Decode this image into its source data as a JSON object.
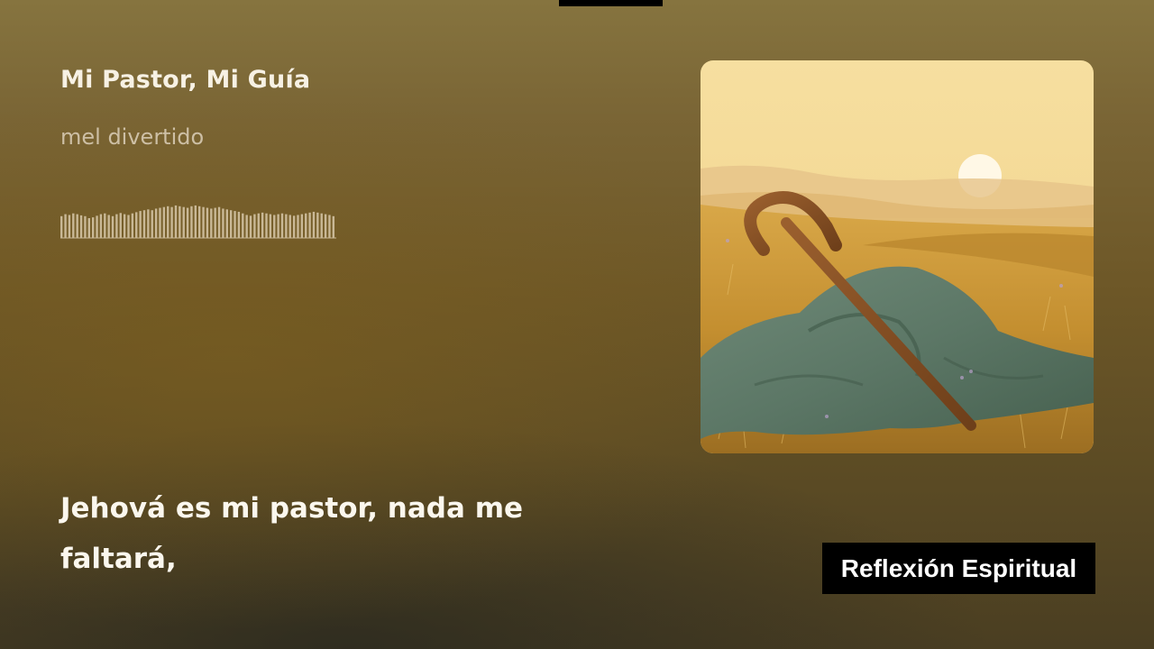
{
  "track": {
    "title": "Mi Pastor, Mi Guía",
    "artist": "mel divertido"
  },
  "lyrics": {
    "current": "Jehová es mi pastor, nada me faltará,"
  },
  "badge": {
    "label": "Reflexión Espiritual"
  },
  "album_art": {
    "subject": "shepherd-staff-on-blanket-in-golden-field-at-sunset"
  },
  "waveform": {
    "levels": [
      0.55,
      0.6,
      0.58,
      0.62,
      0.6,
      0.57,
      0.55,
      0.5,
      0.52,
      0.56,
      0.6,
      0.62,
      0.58,
      0.55,
      0.6,
      0.63,
      0.6,
      0.58,
      0.62,
      0.65,
      0.68,
      0.7,
      0.72,
      0.7,
      0.74,
      0.76,
      0.78,
      0.8,
      0.78,
      0.82,
      0.8,
      0.78,
      0.76,
      0.8,
      0.82,
      0.8,
      0.78,
      0.76,
      0.74,
      0.76,
      0.78,
      0.74,
      0.72,
      0.7,
      0.68,
      0.66,
      0.62,
      0.58,
      0.56,
      0.6,
      0.62,
      0.64,
      0.62,
      0.6,
      0.58,
      0.6,
      0.62,
      0.6,
      0.58,
      0.56,
      0.58,
      0.6,
      0.62,
      0.64,
      0.66,
      0.64,
      0.62,
      0.6,
      0.58,
      0.55
    ],
    "color": "#c9b896"
  },
  "colors": {
    "background_top": "#86743f",
    "background_bottom": "#4a3e22",
    "title": "#f7f1e4",
    "artist": "#cdbfa5",
    "badge_bg": "#000000"
  }
}
